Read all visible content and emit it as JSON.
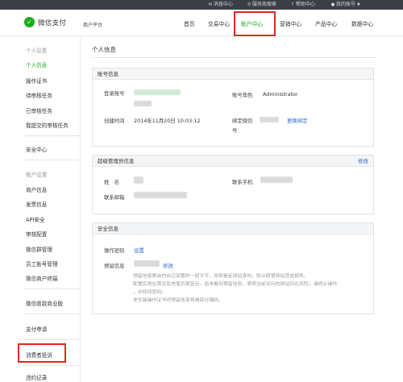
{
  "topbar": {
    "messages": "消息中心",
    "service": "服务商搜索",
    "help": "帮助中心",
    "account": "我的账号"
  },
  "header": {
    "logo_text": "微信支付",
    "logo_sub": "商户平台",
    "nav": [
      "首页",
      "交易中心",
      "账户中心",
      "营销中心",
      "产品中心",
      "数据中心"
    ],
    "active_nav": "账户中心",
    "accent_color": "#1aad19",
    "highlight_color": "#e3261f"
  },
  "sidebar": {
    "group1": "个人设置",
    "item_personal_info": "个人信息",
    "item_op_cert": "操作证书",
    "item_pending_review": "待审核任务",
    "item_reviewed": "已审核任务",
    "item_my_submitted": "我提交的审核任务",
    "security_center": "安全中心",
    "group2": "账户设置",
    "item_merchant_info": "商户信息",
    "item_invoice_info": "发票信息",
    "item_api_security": "API安全",
    "item_review_config": "审核配置",
    "item_wechat_group": "微信群管理",
    "item_staff_wechat": "员工账号管理",
    "item_wechat_products": "微信商户终端",
    "wechat_pay_cashier": "微信收款商业版",
    "pay_apply": "支付申请",
    "consumer_complaint": "消费者投诉",
    "violation_record": "违约记录"
  },
  "main": {
    "page_title": "个人信息",
    "account_panel": {
      "title": "账号信息",
      "login_label": "登录账号",
      "role_label": "账号角色",
      "role_value": "Administrator",
      "created_label": "创建时间",
      "created_value": "2014年11月20日 10:03:12",
      "bind_wechat_label_1": "绑定微信",
      "bind_wechat_label_2": "号",
      "bind_change": "更换绑定"
    },
    "admin_panel": {
      "title": "超级管理员信息",
      "edit": "修改",
      "name_label": "姓　名",
      "phone_label": "联系手机",
      "email_label": "联系邮箱"
    },
    "security_panel": {
      "title": "安全信息",
      "op_password_label": "操作密码",
      "op_password_action": "设置",
      "reserved_info_label": "预留信息",
      "reserved_info_edit": "修改",
      "note_lines": [
        "预留信息是由你自己设置的一段文字，用来鉴定网站身份，防止假冒网站造成损失。",
        "配置后将在首页及充值页面显示。若未看到预留信息，表明当前访问的网站存在风险，请终止操作",
        "，并修改密码。",
        "未安装操作证书时预留信息将被部分掩码。"
      ]
    }
  }
}
